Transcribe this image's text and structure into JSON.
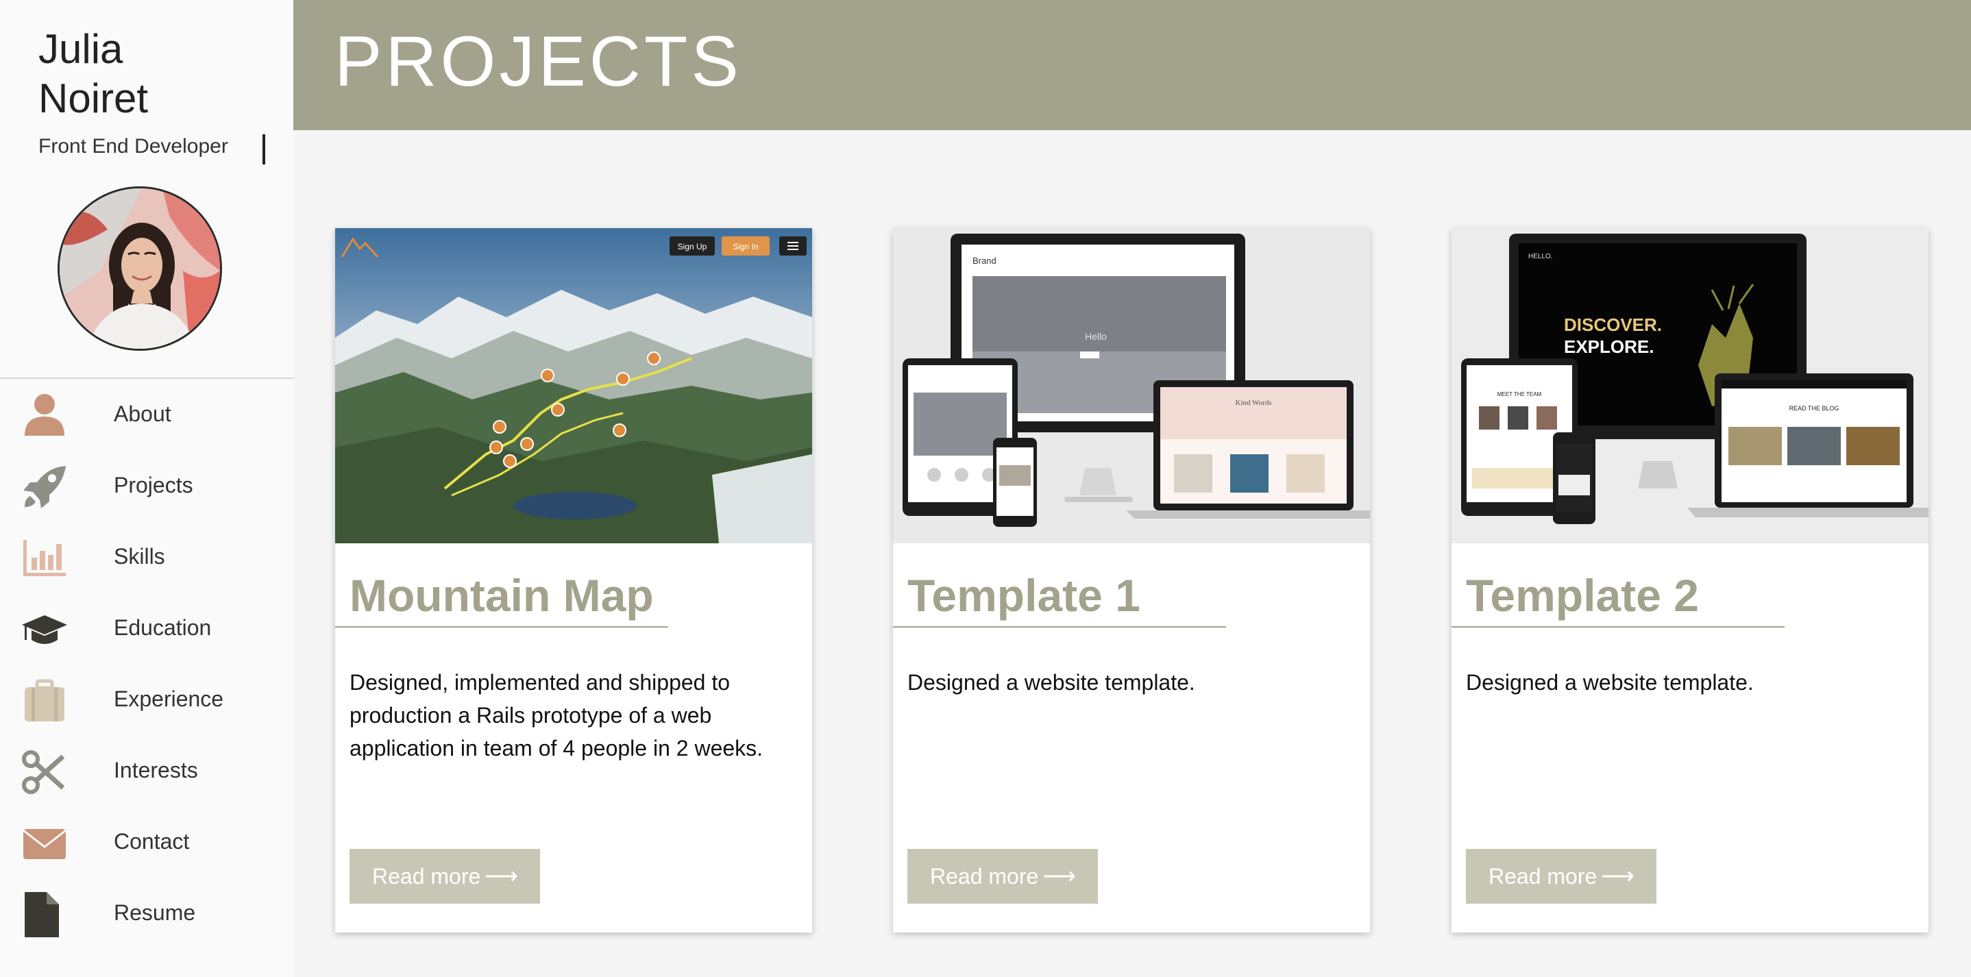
{
  "profile": {
    "first_name": "Julia",
    "last_name": "Noiret",
    "role": "Front End Developer"
  },
  "nav": [
    {
      "label": "About",
      "icon": "person-icon"
    },
    {
      "label": "Projects",
      "icon": "rocket-icon"
    },
    {
      "label": "Skills",
      "icon": "bar-chart-icon"
    },
    {
      "label": "Education",
      "icon": "graduation-cap-icon"
    },
    {
      "label": "Experience",
      "icon": "briefcase-icon"
    },
    {
      "label": "Interests",
      "icon": "scissors-icon"
    },
    {
      "label": "Contact",
      "icon": "envelope-icon"
    },
    {
      "label": "Resume",
      "icon": "document-icon"
    }
  ],
  "header": {
    "title": "PROJECTS"
  },
  "projects": [
    {
      "title": "Mountain Map",
      "description": "Designed, implemented and shipped to production a Rails prototype of a web application in team of 4 people in 2 weeks.",
      "button": "Read more",
      "preview": {
        "sign_up": "Sign Up",
        "sign_in": "Sign In"
      }
    },
    {
      "title": "Template 1",
      "description": "Designed a website template.",
      "button": "Read more",
      "preview": {
        "brand": "Brand",
        "hello": "Hello",
        "kind_words": "Kind Words"
      }
    },
    {
      "title": "Template 2",
      "description": "Designed a website template.",
      "button": "Read more",
      "preview": {
        "hello": "HELLO.",
        "discover": "DISCOVER.",
        "explore": "EXPLORE.",
        "meet_team": "MEET THE TEAM",
        "read_blog": "READ THE BLOG"
      }
    }
  ],
  "colors": {
    "accent": "#a3a28c",
    "button": "#c8c7b6",
    "icon_warm": "#c8957a",
    "icon_dark": "#3a3a32",
    "icon_tan": "#d6c9b4",
    "icon_gray": "#8f8f86"
  }
}
